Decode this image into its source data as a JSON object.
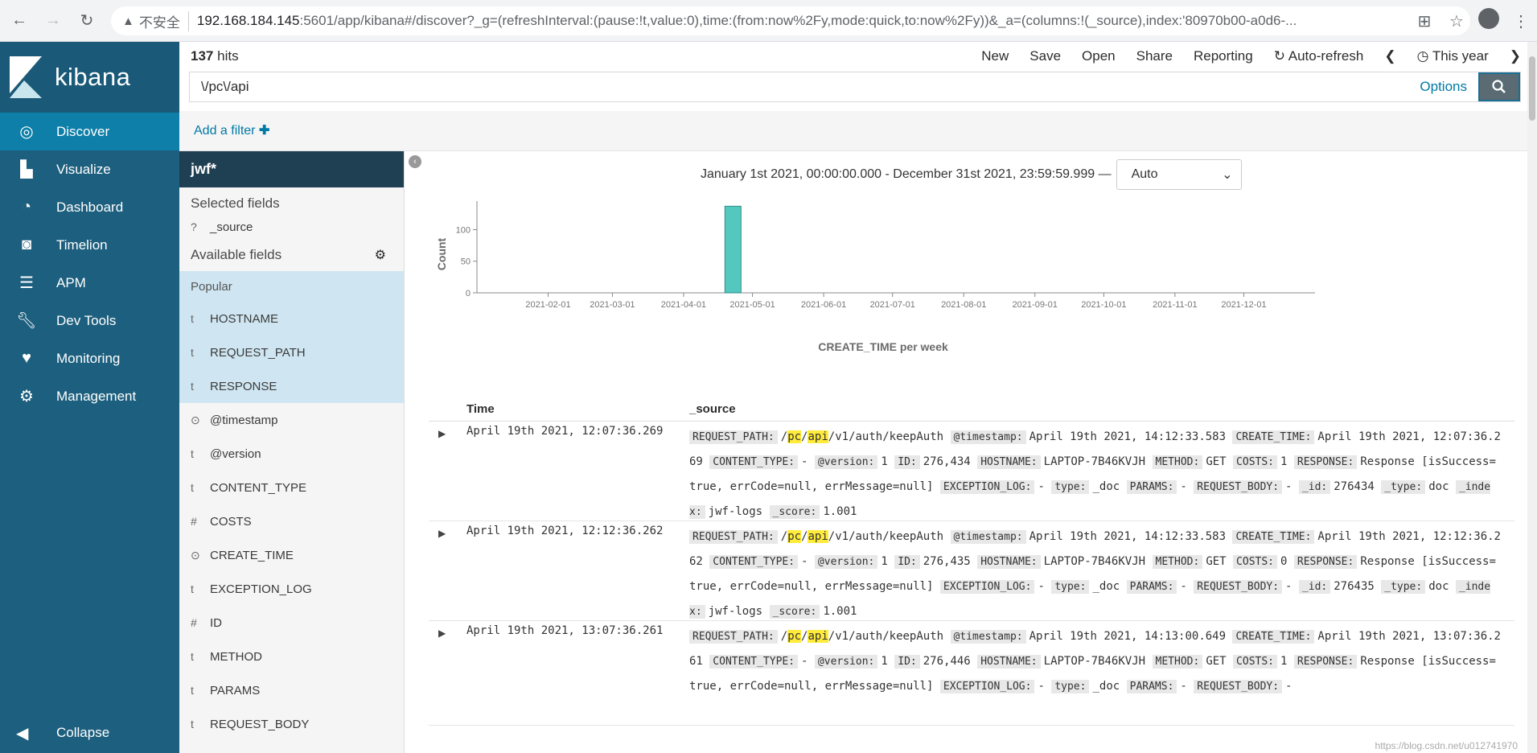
{
  "browser": {
    "insecure_label": "不安全",
    "url_host": "192.168.184.145",
    "url_rest": ":5601/app/kibana#/discover?_g=(refreshInterval:(pause:!t,value:0),time:(from:now%2Fy,mode:quick,to:now%2Fy))&_a=(columns:!(_source),index:'80970b00-a0d6-..."
  },
  "nav": {
    "brand": "kibana",
    "items": [
      {
        "label": "Discover",
        "icon": "compass-icon"
      },
      {
        "label": "Visualize",
        "icon": "bar-chart-icon"
      },
      {
        "label": "Dashboard",
        "icon": "dashboard-icon"
      },
      {
        "label": "Timelion",
        "icon": "timelion-icon"
      },
      {
        "label": "APM",
        "icon": "apm-icon"
      },
      {
        "label": "Dev Tools",
        "icon": "wrench-icon"
      },
      {
        "label": "Monitoring",
        "icon": "heartbeat-icon"
      },
      {
        "label": "Management",
        "icon": "gear-icon"
      }
    ],
    "collapse": "Collapse"
  },
  "top": {
    "hits_count": "137",
    "hits_label": "hits",
    "menu": [
      "New",
      "Save",
      "Open",
      "Share",
      "Reporting",
      "Auto-refresh",
      "This year"
    ],
    "query": "\\/pc\\/api",
    "options": "Options",
    "add_filter": "Add a filter"
  },
  "sidebar": {
    "index_pattern": "jwf*",
    "selected_header": "Selected fields",
    "selected": [
      {
        "type": "?",
        "name": "_source"
      }
    ],
    "available_header": "Available fields",
    "popular_header": "Popular",
    "popular": [
      {
        "type": "t",
        "name": "HOSTNAME"
      },
      {
        "type": "t",
        "name": "REQUEST_PATH"
      },
      {
        "type": "t",
        "name": "RESPONSE"
      }
    ],
    "fields": [
      {
        "type": "⊙",
        "name": "@timestamp"
      },
      {
        "type": "t",
        "name": "@version"
      },
      {
        "type": "t",
        "name": "CONTENT_TYPE"
      },
      {
        "type": "#",
        "name": "COSTS"
      },
      {
        "type": "⊙",
        "name": "CREATE_TIME"
      },
      {
        "type": "t",
        "name": "EXCEPTION_LOG"
      },
      {
        "type": "#",
        "name": "ID"
      },
      {
        "type": "t",
        "name": "METHOD"
      },
      {
        "type": "t",
        "name": "PARAMS"
      },
      {
        "type": "t",
        "name": "REQUEST_BODY"
      }
    ]
  },
  "range": {
    "text": "January 1st 2021, 00:00:00.000 - December 31st 2021, 23:59:59.999 —",
    "interval": "Auto"
  },
  "chart_data": {
    "type": "bar",
    "xlabel": "CREATE_TIME per week",
    "ylabel": "Count",
    "ylim": [
      0,
      140
    ],
    "yticks": [
      0,
      50,
      100
    ],
    "xticks": [
      "2021-02-01",
      "2021-03-01",
      "2021-04-01",
      "2021-05-01",
      "2021-06-01",
      "2021-07-01",
      "2021-08-01",
      "2021-09-01",
      "2021-10-01",
      "2021-11-01",
      "2021-12-01"
    ],
    "bars": [
      {
        "week_start": "2021-04-19",
        "value": 137
      }
    ],
    "color": "#54c7bf"
  },
  "table": {
    "col_time": "Time",
    "col_source": "_source",
    "rows": [
      {
        "time": "April 19th 2021, 12:07:36.269",
        "fields": [
          [
            "REQUEST_PATH:",
            "/pc/api/v1/auth/keepAuth"
          ],
          [
            "@timestamp:",
            "April 19th 2021, 14:12:33.583"
          ],
          [
            "CREATE_TIME:",
            "April 19th 2021, 12:07:36.269"
          ],
          [
            "CONTENT_TYPE:",
            "-"
          ],
          [
            "@version:",
            "1"
          ],
          [
            "ID:",
            "276,434"
          ],
          [
            "HOSTNAME:",
            "LAPTOP-7B46KVJH"
          ],
          [
            "METHOD:",
            "GET"
          ],
          [
            "COSTS:",
            "1"
          ],
          [
            "RESPONSE:",
            "Response [isSuccess=true, errCode=null, errMessage=null]"
          ],
          [
            "EXCEPTION_LOG:",
            "-"
          ],
          [
            "type:",
            "_doc"
          ],
          [
            "PARAMS:",
            "-"
          ],
          [
            "REQUEST_BODY:",
            "-"
          ],
          [
            "_id:",
            "276434"
          ],
          [
            "_type:",
            "doc"
          ],
          [
            "_index:",
            "jwf-logs"
          ],
          [
            "_score:",
            "1.001"
          ]
        ]
      },
      {
        "time": "April 19th 2021, 12:12:36.262",
        "fields": [
          [
            "REQUEST_PATH:",
            "/pc/api/v1/auth/keepAuth"
          ],
          [
            "@timestamp:",
            "April 19th 2021, 14:12:33.583"
          ],
          [
            "CREATE_TIME:",
            "April 19th 2021, 12:12:36.262"
          ],
          [
            "CONTENT_TYPE:",
            "-"
          ],
          [
            "@version:",
            "1"
          ],
          [
            "ID:",
            "276,435"
          ],
          [
            "HOSTNAME:",
            "LAPTOP-7B46KVJH"
          ],
          [
            "METHOD:",
            "GET"
          ],
          [
            "COSTS:",
            "0"
          ],
          [
            "RESPONSE:",
            "Response [isSuccess=true, errCode=null, errMessage=null]"
          ],
          [
            "EXCEPTION_LOG:",
            "-"
          ],
          [
            "type:",
            "_doc"
          ],
          [
            "PARAMS:",
            "-"
          ],
          [
            "REQUEST_BODY:",
            "-"
          ],
          [
            "_id:",
            "276435"
          ],
          [
            "_type:",
            "doc"
          ],
          [
            "_index:",
            "jwf-logs"
          ],
          [
            "_score:",
            "1.001"
          ]
        ]
      },
      {
        "time": "April 19th 2021, 13:07:36.261",
        "fields": [
          [
            "REQUEST_PATH:",
            "/pc/api/v1/auth/keepAuth"
          ],
          [
            "@timestamp:",
            "April 19th 2021, 14:13:00.649"
          ],
          [
            "CREATE_TIME:",
            "April 19th 2021, 13:07:36.261"
          ],
          [
            "CONTENT_TYPE:",
            "-"
          ],
          [
            "@version:",
            "1"
          ],
          [
            "ID:",
            "276,446"
          ],
          [
            "HOSTNAME:",
            "LAPTOP-7B46KVJH"
          ],
          [
            "METHOD:",
            "GET"
          ],
          [
            "COSTS:",
            "1"
          ],
          [
            "RESPONSE:",
            "Response [isSuccess=true, errCode=null, errMessage=null]"
          ],
          [
            "EXCEPTION_LOG:",
            "-"
          ],
          [
            "type:",
            "_doc"
          ],
          [
            "PARAMS:",
            "-"
          ],
          [
            "REQUEST_BODY:",
            "-"
          ]
        ]
      }
    ]
  },
  "watermark": "https://blog.csdn.net/u012741970"
}
